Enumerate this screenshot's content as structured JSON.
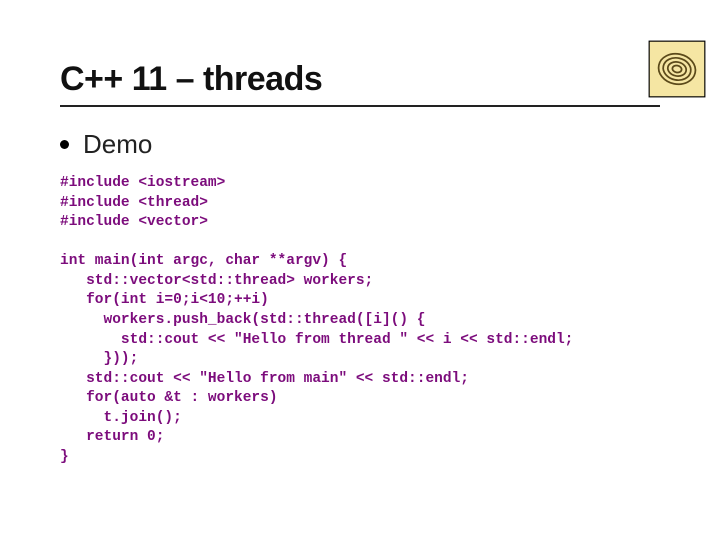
{
  "title": "C++ 11 – threads",
  "bullet": "Demo",
  "code": "#include <iostream>\n#include <thread>\n#include <vector>\n\nint main(int argc, char **argv) {\n   std::vector<std::thread> workers;\n   for(int i=0;i<10;++i)\n     workers.push_back(std::thread([i]() {\n       std::cout << \"Hello from thread \" << i << std::endl;\n     }));\n   std::cout << \"Hello from main\" << std::endl;\n   for(auto &t : workers)\n     t.join();\n   return 0;\n}"
}
